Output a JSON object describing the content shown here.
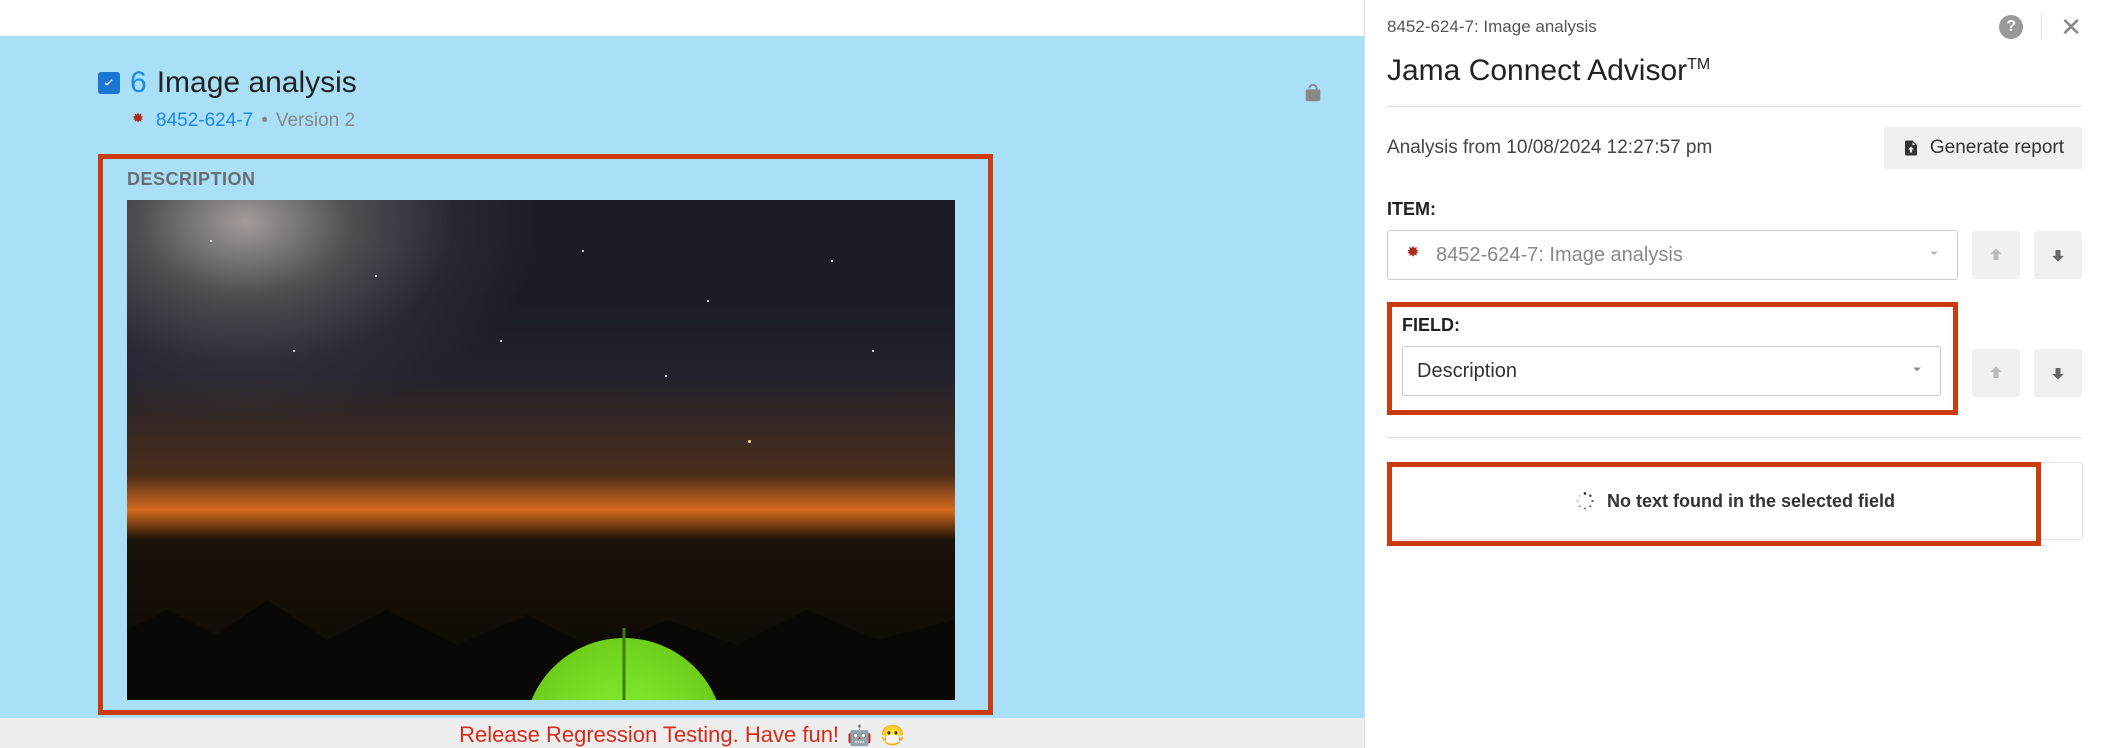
{
  "item": {
    "number": "6",
    "title": "Image analysis",
    "id": "8452-624-7",
    "version": "Version 2",
    "description_label": "DESCRIPTION"
  },
  "advisor": {
    "breadcrumb": "8452-624-7: Image analysis",
    "title": "Jama Connect Advisor",
    "title_tm": "TM",
    "analysis_from": "Analysis from 10/08/2024 12:27:57 pm",
    "generate_report": "Generate report",
    "item_label": "ITEM:",
    "item_value": "8452-624-7: Image analysis",
    "field_label": "FIELD:",
    "field_value": "Description",
    "no_text_message": "No text found in the selected field"
  },
  "footer": {
    "text": "Release Regression Testing. Have fun!"
  }
}
